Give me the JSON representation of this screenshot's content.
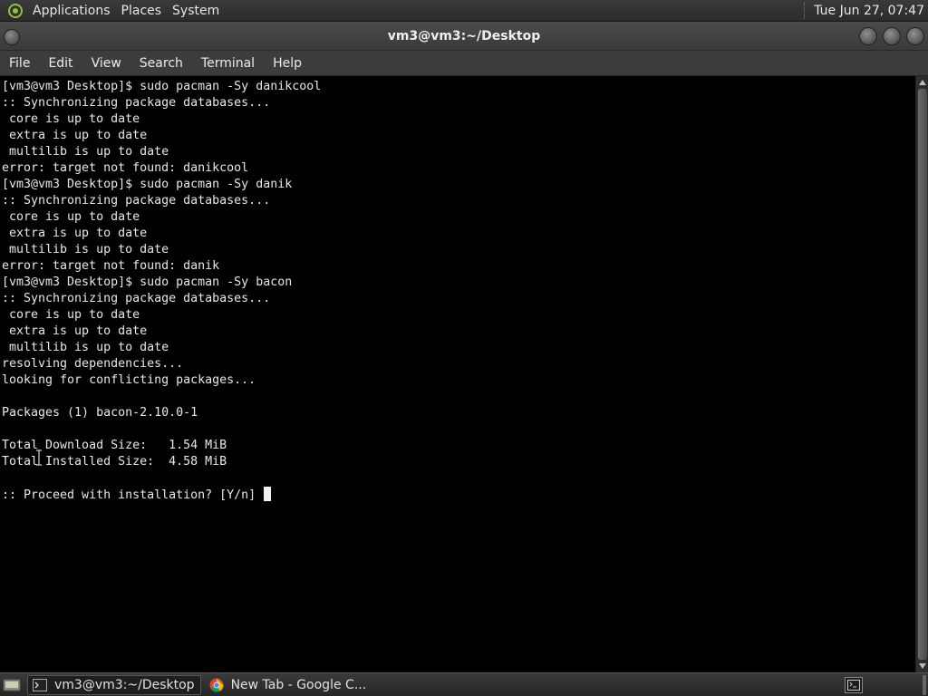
{
  "top_panel": {
    "menus": [
      "Applications",
      "Places",
      "System"
    ],
    "clock": "Tue Jun 27, 07:47",
    "logo_icon": "distro-logo-icon"
  },
  "window": {
    "title": "vm3@vm3:~/Desktop",
    "menu": [
      "File",
      "Edit",
      "View",
      "Search",
      "Terminal",
      "Help"
    ]
  },
  "terminal": {
    "lines": [
      "[vm3@vm3 Desktop]$ sudo pacman -Sy danikcool",
      ":: Synchronizing package databases...",
      " core is up to date",
      " extra is up to date",
      " multilib is up to date",
      "error: target not found: danikcool",
      "[vm3@vm3 Desktop]$ sudo pacman -Sy danik",
      ":: Synchronizing package databases...",
      " core is up to date",
      " extra is up to date",
      " multilib is up to date",
      "error: target not found: danik",
      "[vm3@vm3 Desktop]$ sudo pacman -Sy bacon",
      ":: Synchronizing package databases...",
      " core is up to date",
      " extra is up to date",
      " multilib is up to date",
      "resolving dependencies...",
      "looking for conflicting packages...",
      "",
      "Packages (1) bacon-2.10.0-1",
      "",
      "Total Download Size:   1.54 MiB",
      "Total Installed Size:  4.58 MiB",
      "",
      ":: Proceed with installation? [Y/n] "
    ]
  },
  "taskbar": {
    "tasks": [
      {
        "label": "vm3@vm3:~/Desktop",
        "icon": "terminal-icon",
        "active": true
      },
      {
        "label": "New Tab - Google C...",
        "icon": "chrome-icon",
        "active": false
      }
    ]
  },
  "colors": {
    "terminal_bg": "#000000",
    "terminal_fg": "#e8e8e8",
    "panel_bg": "#2b2b2b"
  }
}
